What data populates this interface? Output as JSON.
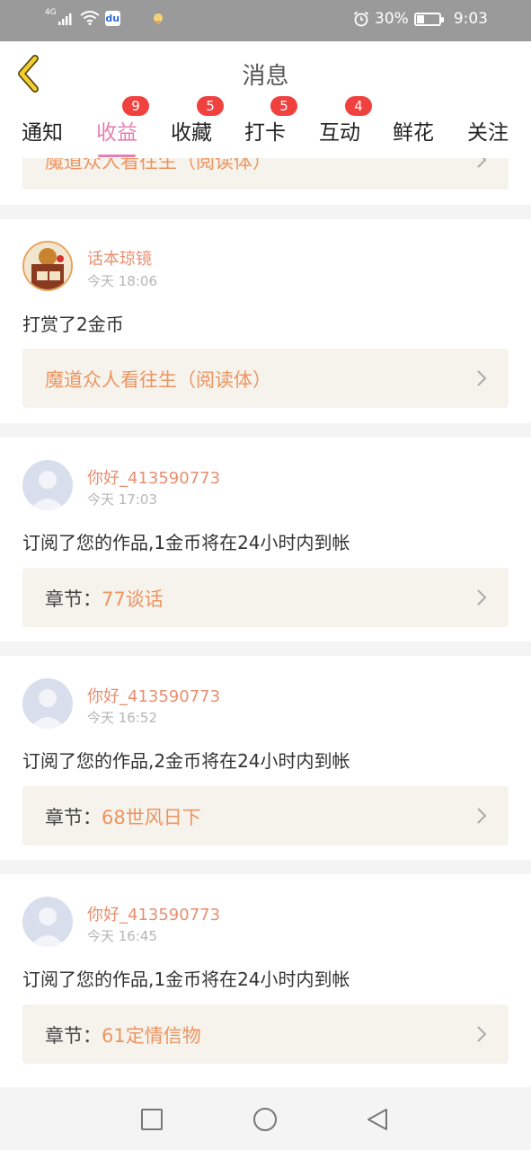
{
  "status": {
    "network": "4G",
    "battery": "30%",
    "battery_level": 0.3,
    "time": "9:03"
  },
  "header": {
    "title": "消息"
  },
  "tabs": [
    {
      "label": "通知",
      "badge": ""
    },
    {
      "label": "收益",
      "badge": "9"
    },
    {
      "label": "收藏",
      "badge": "5"
    },
    {
      "label": "打卡",
      "badge": "5"
    },
    {
      "label": "互动",
      "badge": "4"
    },
    {
      "label": "鲜花",
      "badge": ""
    },
    {
      "label": "关注",
      "badge": ""
    }
  ],
  "feed": {
    "partial_link": "魔道众人看往生（阅读体）",
    "items": [
      {
        "username": "话本琼镜",
        "time": "今天 18:06",
        "message": "打赏了2金币",
        "link_prefix": "",
        "link_value": "魔道众人看往生（阅读体）"
      },
      {
        "username": "你好_413590773",
        "time": "今天 17:03",
        "message": "订阅了您的作品,1金币将在24小时内到帐",
        "link_prefix": "章节：",
        "link_value": "77谈话"
      },
      {
        "username": "你好_413590773",
        "time": "今天 16:52",
        "message": "订阅了您的作品,2金币将在24小时内到帐",
        "link_prefix": "章节：",
        "link_value": "68世风日下"
      },
      {
        "username": "你好_413590773",
        "time": "今天 16:45",
        "message": "订阅了您的作品,1金币将在24小时内到帐",
        "link_prefix": "章节：",
        "link_value": "61定情信物"
      }
    ]
  },
  "colors": {
    "accent": "#e67fb0",
    "badge": "#f0413f",
    "link": "#ee9460",
    "username": "#e88f70"
  }
}
